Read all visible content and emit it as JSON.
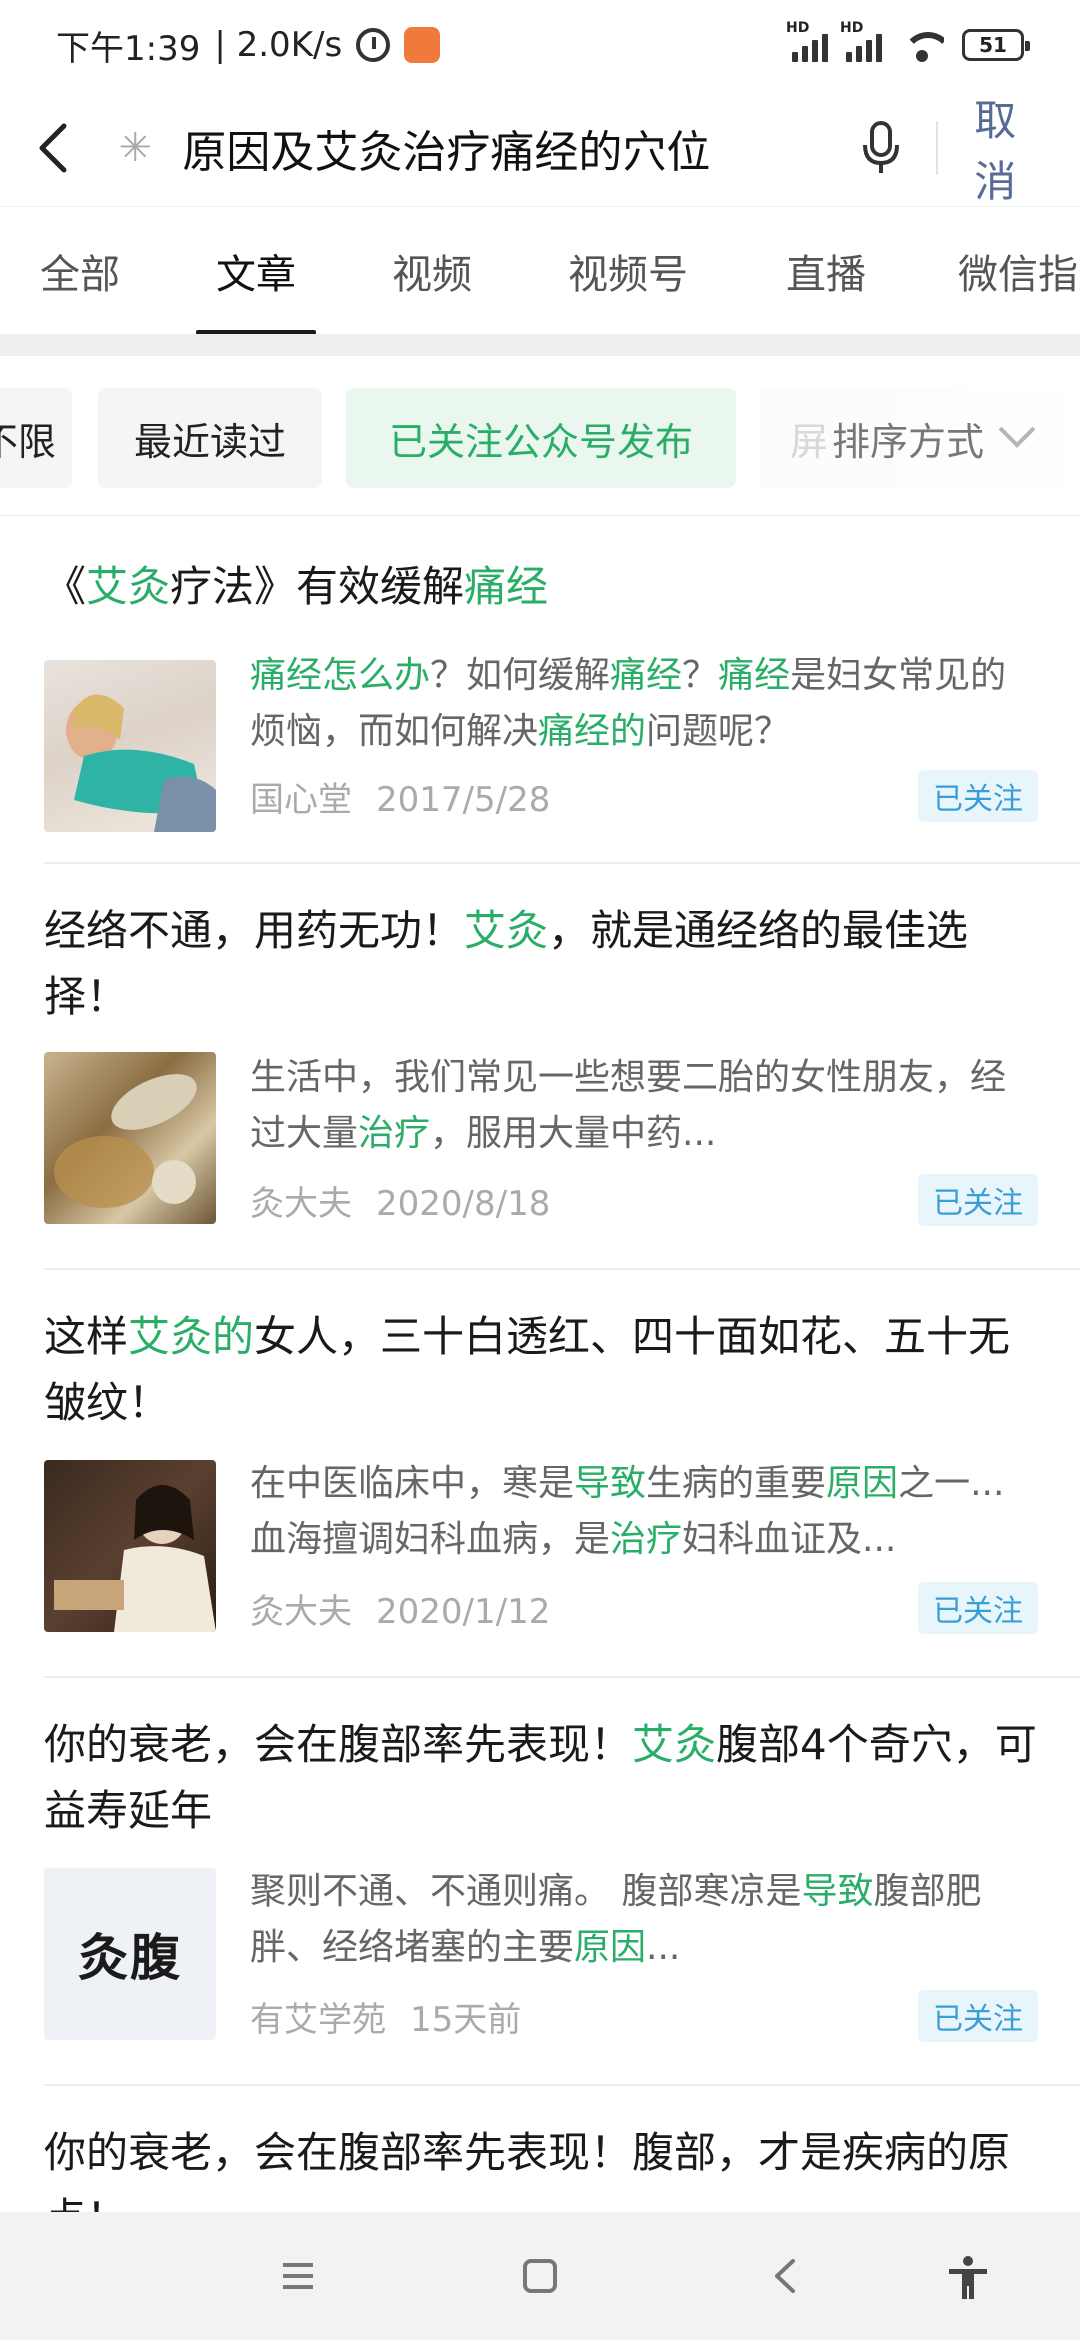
{
  "status_bar": {
    "time": "下午1:39",
    "speed": "| 2.0K/s",
    "hd_label": "HD",
    "battery": "51"
  },
  "search": {
    "back_icon": "back-arrow-icon",
    "clear_icon": "clear-icon",
    "query": "原因及艾灸治疗痛经的穴位",
    "mic_icon": "microphone-icon",
    "cancel_label": "取消"
  },
  "tabs": [
    "全部",
    "文章",
    "视频",
    "视频号",
    "直播",
    "微信指数"
  ],
  "active_tab": "文章",
  "filters": {
    "chips": [
      "不限",
      "最近读过",
      "已关注公众号发布"
    ],
    "active_chip": "已关注公众号发布",
    "sort_label": "排序方式",
    "sort_fade_char": "屏"
  },
  "results": [
    {
      "title_parts": [
        {
          "t": "《",
          "hl": false
        },
        {
          "t": "艾灸",
          "hl": true
        },
        {
          "t": "疗法》有效缓解",
          "hl": false
        },
        {
          "t": "痛经",
          "hl": true
        }
      ],
      "snippet_parts": [
        {
          "t": "痛经怎么办",
          "hl": true
        },
        {
          "t": "？如何缓解",
          "hl": false
        },
        {
          "t": "痛经",
          "hl": true
        },
        {
          "t": "？",
          "hl": false
        },
        {
          "t": "痛经",
          "hl": true
        },
        {
          "t": "是妇女常见的烦恼，而如何解决",
          "hl": false
        },
        {
          "t": "痛经的",
          "hl": true
        },
        {
          "t": "问题呢？",
          "hl": false
        }
      ],
      "source": "国心堂",
      "date": "2017/5/28",
      "badge": "已关注"
    },
    {
      "title_parts": [
        {
          "t": "经络不通，用药无功！",
          "hl": false
        },
        {
          "t": "艾灸",
          "hl": true
        },
        {
          "t": "，就是通经络的最佳选择！",
          "hl": false
        }
      ],
      "snippet_parts": [
        {
          "t": "生活中，我们常见一些想要二胎的女性朋友，经过大量",
          "hl": false
        },
        {
          "t": "治疗",
          "hl": true
        },
        {
          "t": "，服用大量中药...",
          "hl": false
        }
      ],
      "source": "灸大夫",
      "date": "2020/8/18",
      "badge": "已关注"
    },
    {
      "title_parts": [
        {
          "t": "这样",
          "hl": false
        },
        {
          "t": "艾灸的",
          "hl": true
        },
        {
          "t": "女人，三十白透红、四十面如花、五十无皱纹！",
          "hl": false
        }
      ],
      "snippet_parts": [
        {
          "t": "在中医临床中，寒是",
          "hl": false
        },
        {
          "t": "导致",
          "hl": true
        },
        {
          "t": "生病的重要",
          "hl": false
        },
        {
          "t": "原因",
          "hl": true
        },
        {
          "t": "之一...血海擅调妇科血病，是",
          "hl": false
        },
        {
          "t": "治疗",
          "hl": true
        },
        {
          "t": "妇科血证及...",
          "hl": false
        }
      ],
      "source": "灸大夫",
      "date": "2020/1/12",
      "badge": "已关注"
    },
    {
      "title_parts": [
        {
          "t": "你的衰老，会在腹部率先表现！",
          "hl": false
        },
        {
          "t": "艾灸",
          "hl": true
        },
        {
          "t": "腹部4个奇穴，可益寿延年",
          "hl": false
        }
      ],
      "snippet_parts": [
        {
          "t": "聚则不通、不通则痛。 腹部寒凉是",
          "hl": false
        },
        {
          "t": "导致",
          "hl": true
        },
        {
          "t": "腹部肥胖、经络堵塞的主要",
          "hl": false
        },
        {
          "t": "原因",
          "hl": true
        },
        {
          "t": "...",
          "hl": false
        }
      ],
      "source": "有艾学苑",
      "date": "15天前",
      "badge": "已关注",
      "thumb_text": "灸腹"
    },
    {
      "title_parts": [
        {
          "t": "你的衰老，会在腹部率先表现！腹部，才是疾病的原点！",
          "hl": false
        }
      ]
    }
  ],
  "nav": {
    "menu_icon": "menu-icon",
    "home_icon": "home-icon",
    "back_icon": "back-icon",
    "accessibility_icon": "accessibility-icon"
  },
  "colors": {
    "highlight": "#2aae67",
    "cancel": "#576b95",
    "badge_text": "#3a9ed6",
    "badge_bg": "#e8f6fb"
  }
}
